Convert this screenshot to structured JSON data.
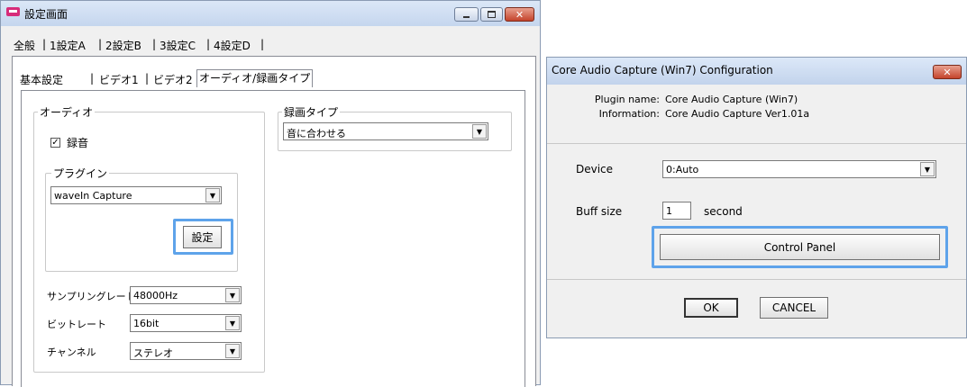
{
  "settings_window": {
    "title": "設定画面",
    "main_tabs": [
      "全般",
      "1設定A",
      "2設定B",
      "3設定C",
      "4設定D"
    ],
    "sub_tabs": [
      "基本設定",
      "ビデオ1",
      "ビデオ2",
      "オーディオ/録画タイプ"
    ],
    "audio_group": {
      "label": "オーディオ",
      "record_checkbox_label": "録音",
      "record_checked": true,
      "plugin_group_label": "プラグイン",
      "plugin_value": "waveIn Capture",
      "settings_button": "設定",
      "sampling_rate_label": "サンプリングレート",
      "sampling_rate_value": "48000Hz",
      "bitrate_label": "ビットレート",
      "bitrate_value": "16bit",
      "channel_label": "チャンネル",
      "channel_value": "ステレオ"
    },
    "record_type_group": {
      "label": "録画タイプ",
      "value": "音に合わせる"
    }
  },
  "config_dialog": {
    "title": "Core Audio Capture (Win7) Configuration",
    "plugin_name_label": "Plugin name:",
    "plugin_name_value": "Core Audio Capture (Win7)",
    "information_label": "Information:",
    "information_value": "Core Audio Capture Ver1.01a",
    "device_label": "Device",
    "device_value": "0:Auto",
    "buff_size_label": "Buff size",
    "buff_size_value": "1",
    "buff_size_unit": "second",
    "control_panel_button": "Control Panel",
    "ok_button": "OK",
    "cancel_button": "CANCEL"
  },
  "colors": {
    "highlight": "#5ea3ea",
    "close_button": "#c4432b",
    "titlebar": "#c5d6ee"
  },
  "icons": [
    "app-icon",
    "minimize-icon",
    "maximize-icon",
    "close-icon",
    "checkbox-checked-icon",
    "dropdown-arrow-icon"
  ]
}
